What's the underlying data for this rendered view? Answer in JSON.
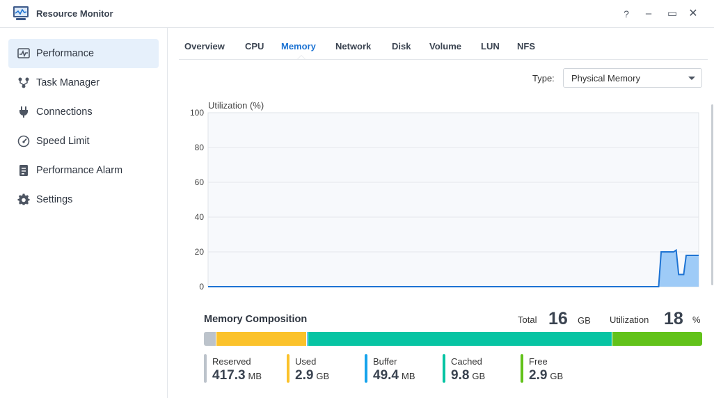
{
  "window": {
    "title": "Resource Monitor",
    "buttons": {
      "help": "?",
      "minimize": "–",
      "maximize": "▭",
      "close": "✕"
    }
  },
  "sidebar": {
    "items": [
      {
        "label": "Performance",
        "icon": "performance-icon",
        "active": true
      },
      {
        "label": "Task Manager",
        "icon": "task-manager-icon",
        "active": false
      },
      {
        "label": "Connections",
        "icon": "plug-icon",
        "active": false
      },
      {
        "label": "Speed Limit",
        "icon": "speedometer-icon",
        "active": false
      },
      {
        "label": "Performance Alarm",
        "icon": "alarm-clipboard-icon",
        "active": false
      },
      {
        "label": "Settings",
        "icon": "gear-icon",
        "active": false
      }
    ]
  },
  "tabs": {
    "items": [
      "Overview",
      "CPU",
      "Memory",
      "Network",
      "Disk",
      "Volume",
      "LUN",
      "NFS"
    ],
    "active": "Memory"
  },
  "type_select": {
    "label": "Type:",
    "value": "Physical Memory"
  },
  "chart_data": {
    "type": "area",
    "title": "Utilization (%)",
    "ylim": [
      0,
      100
    ],
    "yticks": [
      0,
      20,
      40,
      60,
      80,
      100
    ],
    "grid": true,
    "color": "#1d73d3",
    "fill_color": "#99c8f7",
    "y": [
      0,
      0,
      0,
      0,
      0,
      0,
      0,
      0,
      0,
      0,
      0,
      0,
      0,
      0,
      0,
      0,
      0,
      0,
      0,
      0,
      0,
      0,
      0,
      0,
      0,
      0,
      0,
      0,
      0,
      0,
      0,
      0,
      0,
      0,
      0,
      0,
      0,
      0,
      0,
      0,
      0,
      0,
      0,
      0,
      0,
      0,
      0,
      0,
      0,
      0,
      0,
      0,
      0,
      0,
      0,
      0,
      0,
      0,
      0,
      0,
      0,
      0,
      0,
      0,
      0,
      0,
      0,
      0,
      0,
      0,
      0,
      0,
      0,
      0,
      0,
      0,
      0,
      0,
      0,
      0,
      0,
      0,
      0,
      0,
      0,
      0,
      0,
      0,
      0,
      0,
      0,
      0,
      0,
      0,
      0,
      0,
      0,
      0,
      0,
      0,
      0,
      0,
      0,
      0,
      0,
      0,
      0,
      0,
      0,
      0,
      0,
      0,
      0,
      0,
      0,
      0,
      0,
      0,
      0,
      0,
      0,
      0,
      0,
      0,
      0,
      0,
      0,
      0,
      0,
      0,
      0,
      0,
      0,
      0,
      0,
      0,
      0,
      0,
      0,
      0,
      0,
      0,
      0,
      0,
      0,
      0,
      0,
      0,
      0,
      0,
      0,
      0,
      0,
      0,
      0,
      0,
      0,
      0,
      0,
      0,
      0,
      0,
      0,
      0,
      0,
      0,
      0,
      0,
      0,
      0,
      0,
      0,
      0,
      0,
      0,
      0,
      0,
      0,
      0,
      0,
      0,
      20,
      20,
      20,
      20,
      20,
      20,
      21,
      7,
      7,
      7,
      18,
      18,
      18,
      18,
      18,
      18
    ]
  },
  "composition": {
    "title": "Memory Composition",
    "total_label": "Total",
    "total_value": "16",
    "total_unit": "GB",
    "util_label": "Utilization",
    "util_value": "18",
    "util_unit": "%",
    "segments": [
      {
        "name": "Reserved",
        "value": "417.3",
        "unit": "MB",
        "gb": 0.41,
        "color": "#bcc3cb"
      },
      {
        "name": "Used",
        "value": "2.9",
        "unit": "GB",
        "gb": 2.9,
        "color": "#fbc22b"
      },
      {
        "name": "Buffer",
        "value": "49.4",
        "unit": "MB",
        "gb": 0.05,
        "color": "#17a4ec"
      },
      {
        "name": "Cached",
        "value": "9.8",
        "unit": "GB",
        "gb": 9.8,
        "color": "#07c4a3"
      },
      {
        "name": "Free",
        "value": "2.9",
        "unit": "GB",
        "gb": 2.9,
        "color": "#62c21a"
      }
    ]
  }
}
